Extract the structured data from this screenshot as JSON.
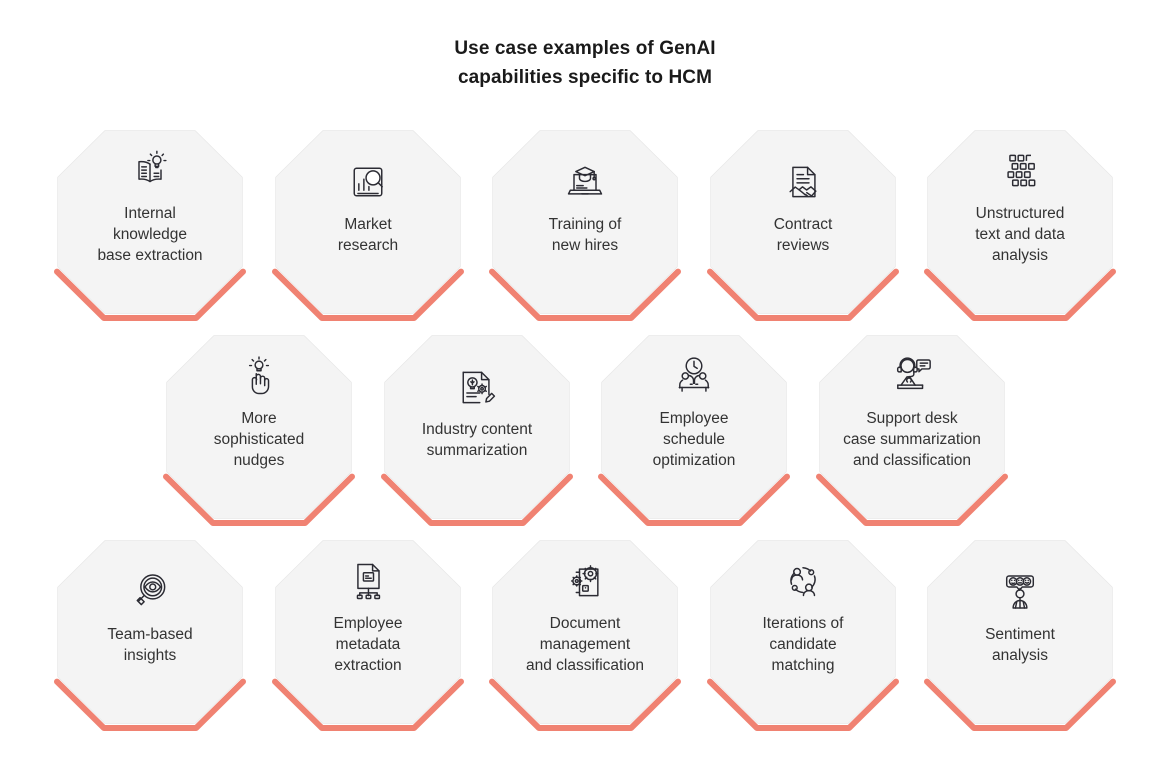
{
  "title": {
    "line1": "Use case examples of GenAI",
    "line2": "capabilities specific to HCM"
  },
  "theme": {
    "background": "#ffffff",
    "hex_fill": "#f4f4f4",
    "hex_stroke": "#e7e7e7",
    "accent": "#f08272",
    "text": "#333333",
    "title_text": "#1a1a1a",
    "icon_stroke": "#2b2b33"
  },
  "rows": [
    {
      "name": "row-1",
      "cells": [
        {
          "label": "Internal\nknowledge\nbase extraction",
          "icon": "open-book-lightbulb-icon"
        },
        {
          "label": "Market\nresearch",
          "icon": "chart-magnifier-icon"
        },
        {
          "label": "Training of\nnew hires",
          "icon": "laptop-graduation-cap-icon"
        },
        {
          "label": "Contract\nreviews",
          "icon": "document-handshake-icon"
        },
        {
          "label": "Unstructured\ntext and data\nanalysis",
          "icon": "data-squares-grid-icon"
        }
      ]
    },
    {
      "name": "row-2",
      "cells": [
        {
          "label": "More\nsophisticated\nnudges",
          "icon": "hand-tap-lightbulb-icon"
        },
        {
          "label": "Industry content\nsummarization",
          "icon": "document-lightbulb-gear-icon"
        },
        {
          "label": "Employee\nschedule\noptimization",
          "icon": "person-clock-desk-icon"
        },
        {
          "label": "Support desk\ncase summarization\nand classification",
          "icon": "headset-agent-chat-icon"
        }
      ]
    },
    {
      "name": "row-3",
      "cells": [
        {
          "label": "Team-based\ninsights",
          "icon": "magnifier-eye-icon"
        },
        {
          "label": "Employee\nmetadata\nextraction",
          "icon": "document-network-icon"
        },
        {
          "label": "Document\nmanagement\nand classification",
          "icon": "document-gears-icon"
        },
        {
          "label": "Iterations of\ncandidate\nmatching",
          "icon": "people-cycle-icon"
        },
        {
          "label": "Sentiment\nanalysis",
          "icon": "person-emoji-chat-icon"
        }
      ]
    }
  ],
  "layout": {
    "hex_width": 190,
    "hex_height": 188,
    "row_tops": [
      128,
      333,
      538
    ],
    "row1_lefts": [
      55,
      273,
      490,
      708,
      925
    ],
    "row2_lefts": [
      164,
      382,
      599,
      817
    ],
    "row3_lefts": [
      55,
      273,
      490,
      708,
      925
    ]
  }
}
